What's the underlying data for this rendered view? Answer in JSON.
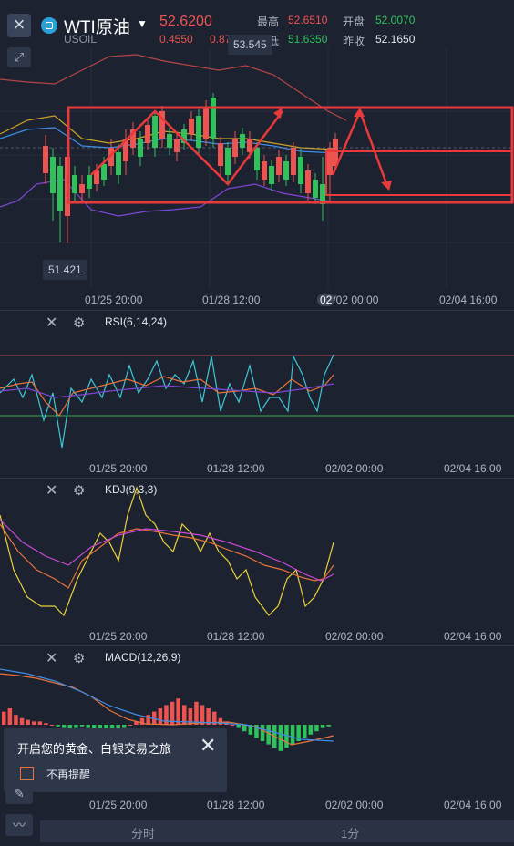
{
  "header": {
    "symbol": "WTI原油",
    "subtitle": "USOIL",
    "price": "52.6200",
    "change": "0.4550",
    "change_pct": "0.87%",
    "high_label": "最高",
    "high": "52.6510",
    "open_label": "开盘",
    "open": "52.0070",
    "low_label": "最低",
    "low": "51.6350",
    "prev_label": "昨收",
    "prev_close": "52.1650"
  },
  "main_chart": {
    "high_tag": "53.545",
    "low_tag": "51.421",
    "cursor_badge": "02",
    "time_labels": [
      "01/25 20:00",
      "01/28 12:00",
      "02/02 00:00",
      "02/04 16:00"
    ]
  },
  "rsi": {
    "title": "RSI(6,14,24)",
    "time_labels": [
      "01/25 20:00",
      "01/28 12:00",
      "02/02 00:00",
      "02/04 16:00"
    ]
  },
  "kdj": {
    "title": "KDJ(9,3,3)",
    "time_labels": [
      "01/25 20:00",
      "01/28 12:00",
      "02/02 00:00",
      "02/04 16:00"
    ]
  },
  "macd": {
    "title": "MACD(12,26,9)",
    "time_labels": [
      "01/25 20:00",
      "01/28 12:00",
      "02/02 00:00",
      "02/04 16:00"
    ]
  },
  "popup": {
    "title": "开启您的黄金、白银交易之旅",
    "checkbox_label": "不再提醒"
  },
  "tabs": [
    "分时",
    "1分"
  ],
  "colors": {
    "up": "#ef5350",
    "down": "#2fc25b",
    "annotation": "#e8393b",
    "bg": "#1c2230"
  }
}
